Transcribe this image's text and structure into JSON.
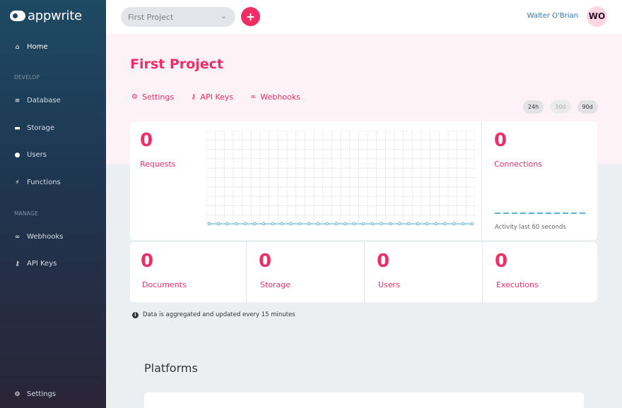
{
  "app": {
    "logo_text": "appwrite"
  },
  "sidebar": {
    "home": {
      "label": "Home",
      "icon": "home-icon"
    },
    "sections": {
      "develop": "DEVELOP",
      "manage": "MANAGE"
    },
    "develop_items": [
      {
        "label": "Database",
        "icon": "database-icon"
      },
      {
        "label": "Storage",
        "icon": "folder-icon"
      },
      {
        "label": "Users",
        "icon": "users-icon"
      },
      {
        "label": "Functions",
        "icon": "bolt-icon"
      }
    ],
    "manage_items": [
      {
        "label": "Webhooks",
        "icon": "link-icon"
      },
      {
        "label": "API Keys",
        "icon": "key-icon"
      }
    ],
    "settings": {
      "label": "Settings",
      "icon": "gear-icon"
    }
  },
  "header": {
    "project_select": "First Project",
    "user_name": "Walter O'Brian",
    "avatar_initials": "WO"
  },
  "page": {
    "title": "First Project",
    "tabs": [
      {
        "label": "Settings",
        "icon": "gear-icon"
      },
      {
        "label": "API Keys",
        "icon": "key-icon"
      },
      {
        "label": "Webhooks",
        "icon": "link-icon"
      }
    ],
    "ranges": [
      "24h",
      "30d",
      "90d"
    ],
    "selected_range": "24h"
  },
  "stats": {
    "requests": {
      "value": "0",
      "label": "Requests"
    },
    "connections": {
      "value": "0",
      "label": "Connections",
      "activity_label": "Activity last 60 seconds"
    },
    "documents": {
      "value": "0",
      "label": "Documents"
    },
    "storage": {
      "value": "0",
      "label": "Storage"
    },
    "users": {
      "value": "0",
      "label": "Users"
    },
    "executions": {
      "value": "0",
      "label": "Executions"
    }
  },
  "info_text": "Data is aggregated and updated every 15 minutes",
  "platforms": {
    "title": "Platforms"
  },
  "colors": {
    "accent": "#f02e65",
    "link": "#2a7aa6",
    "chart_line": "#5ab3d8"
  }
}
